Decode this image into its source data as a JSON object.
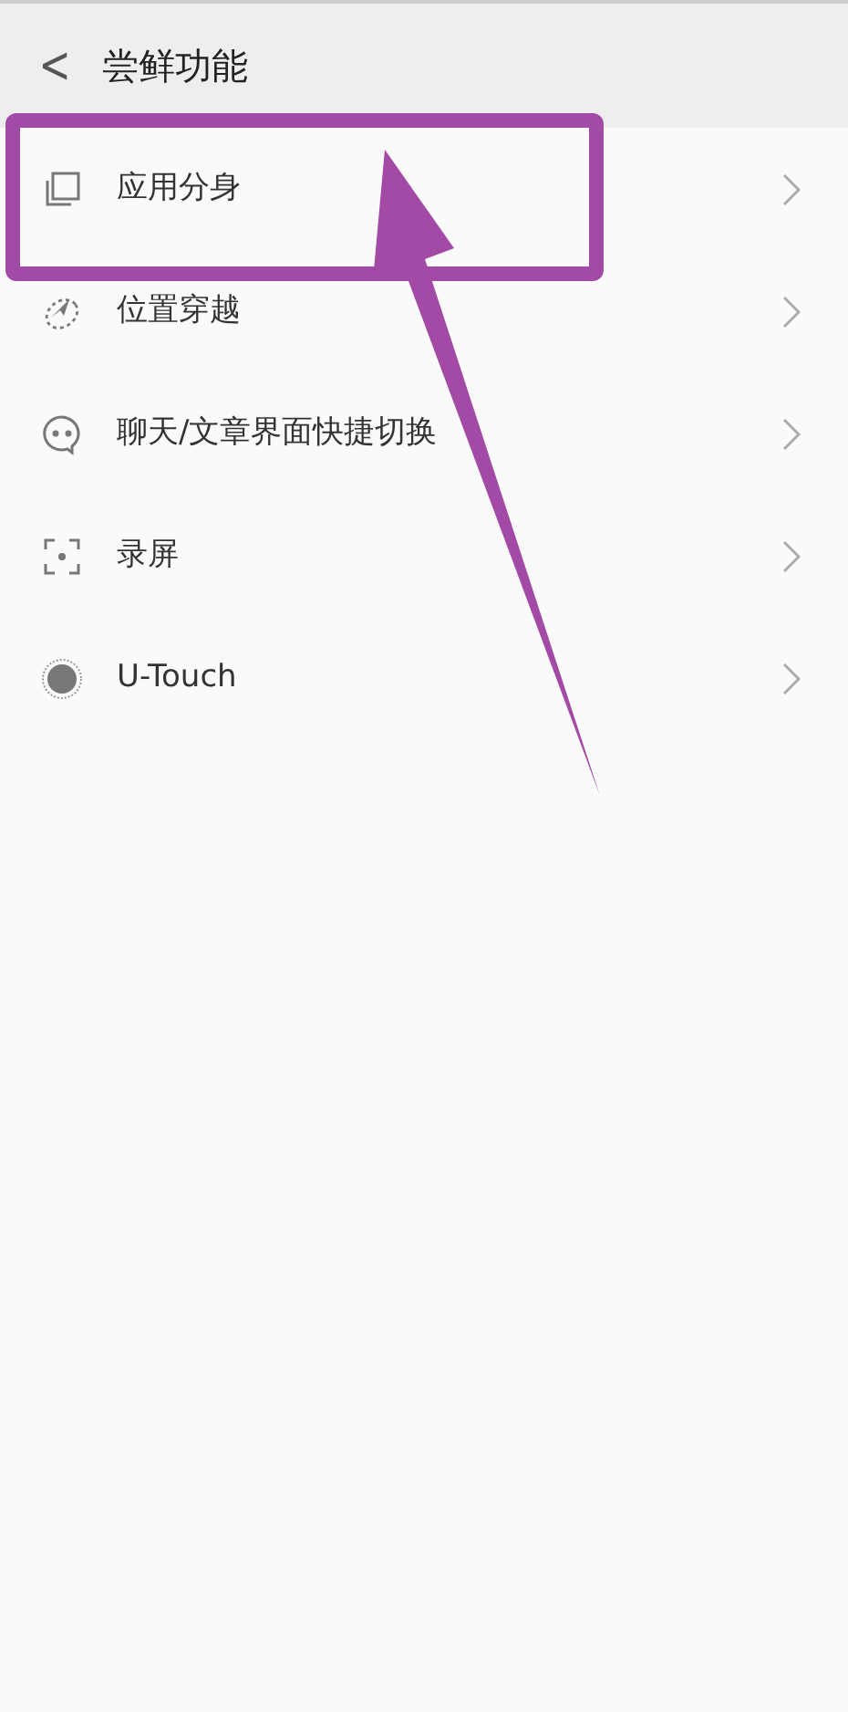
{
  "header": {
    "back": "<",
    "title": "尝鲜功能"
  },
  "items": [
    {
      "kind": "clone",
      "label": "应用分身",
      "highlighted": true
    },
    {
      "kind": "location",
      "label": "位置穿越",
      "highlighted": false
    },
    {
      "kind": "chat",
      "label": "聊天/文章界面快捷切换",
      "highlighted": false
    },
    {
      "kind": "record",
      "label": "录屏",
      "highlighted": false
    },
    {
      "kind": "touch",
      "label": "U-Touch",
      "highlighted": false
    }
  ]
}
